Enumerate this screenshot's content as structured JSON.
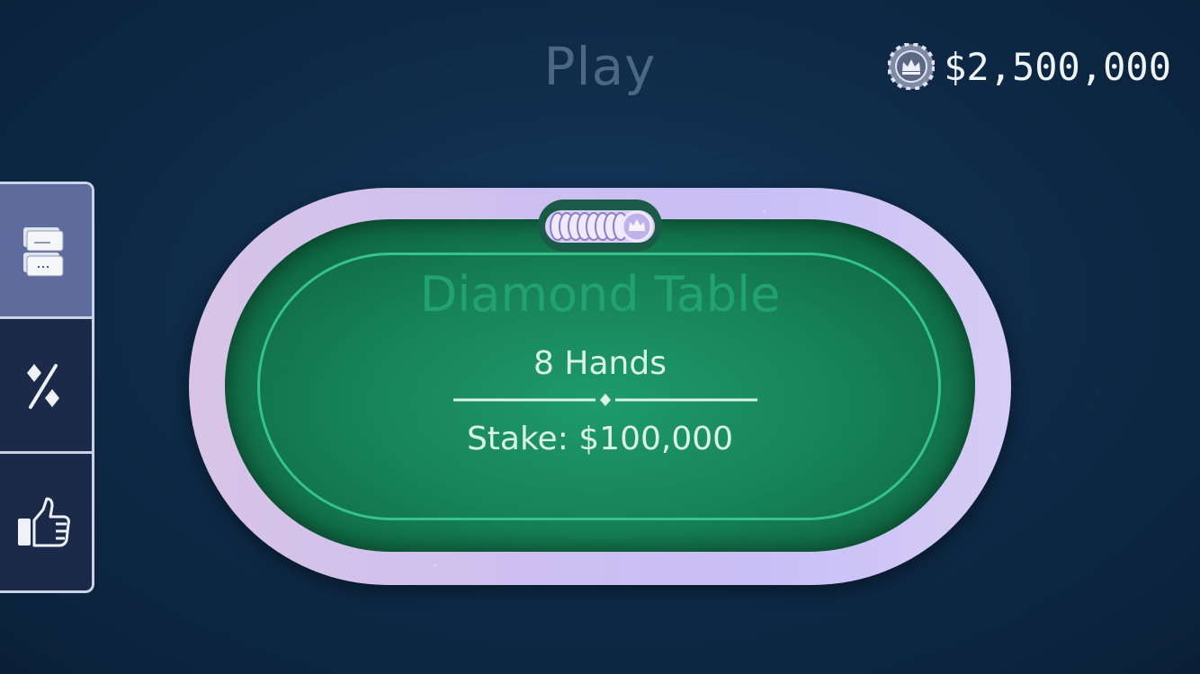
{
  "header": {
    "title": "Play",
    "balance": "$2,500,000",
    "balance_icon": "crown-chip-icon"
  },
  "side_menu": {
    "items": [
      {
        "name": "tables",
        "icon": "tables-list-icon",
        "active": true
      },
      {
        "name": "odds",
        "icon": "diamond-percent-icon",
        "active": false
      },
      {
        "name": "like",
        "icon": "thumbs-up-icon",
        "active": false
      }
    ]
  },
  "table": {
    "name": "Diamond Table",
    "hands": "8 Hands",
    "stake": "Stake: $100,000",
    "felt_color": "#178458",
    "rail_color": "#cdbff0"
  }
}
